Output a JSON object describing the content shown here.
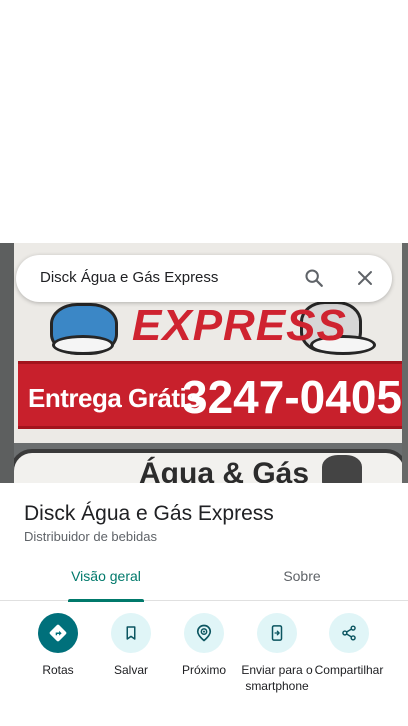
{
  "search": {
    "query": "Disck Água e Gás Express"
  },
  "photo": {
    "sign_express": "EXPRESS",
    "sign_entrega": "Entrega Grátis",
    "sign_phone": "3247-0405",
    "sign_lower": "Água & Gás"
  },
  "place": {
    "name": "Disck Água e Gás Express",
    "category": "Distribuidor de bebidas"
  },
  "tabs": [
    {
      "label": "Visão geral",
      "active": true
    },
    {
      "label": "Sobre",
      "active": false
    }
  ],
  "actions": [
    {
      "label": "Rotas",
      "icon": "directions-icon"
    },
    {
      "label": "Salvar",
      "icon": "bookmark-icon"
    },
    {
      "label": "Próximo",
      "icon": "nearby-icon"
    },
    {
      "label": "Enviar para o smartphone",
      "icon": "send-to-phone-icon"
    },
    {
      "label": "Compartilhar",
      "icon": "share-icon"
    }
  ],
  "colors": {
    "accent": "#00796b",
    "primary_action": "#00707b",
    "action_bg": "#e0f5f7",
    "sign_red": "#c8202c"
  }
}
